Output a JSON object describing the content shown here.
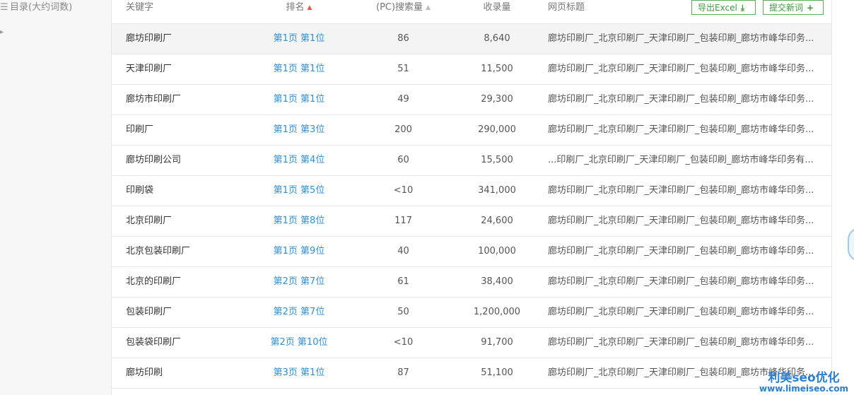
{
  "sidebar": {
    "items": [
      {
        "icon": "list-icon",
        "label": "目录(大约词数)"
      }
    ],
    "caret_icon": "caret-icon"
  },
  "table": {
    "headers": {
      "keyword": "关键字",
      "rank": "排名",
      "pc_search_volume": "(PC)搜索量",
      "indexed": "收录量",
      "page_title": "网页标题"
    },
    "rank_sort": "descending-active",
    "buttons": {
      "export_label": "导出Excel",
      "export_icon": "download-icon",
      "add_label": "提交新词",
      "add_icon": "plus-icon"
    },
    "rows": [
      {
        "keyword": "廊坊印刷厂",
        "rank": "第1页 第1位",
        "volume": "86",
        "indexed": "8,640",
        "title": "廊坊印刷厂_北京印刷厂_天津印刷厂_包装印刷_廊坊市峰华印务..."
      },
      {
        "keyword": "天津印刷厂",
        "rank": "第1页 第1位",
        "volume": "51",
        "indexed": "11,500",
        "title": "廊坊印刷厂_北京印刷厂_天津印刷厂_包装印刷_廊坊市峰华印务..."
      },
      {
        "keyword": "廊坊市印刷厂",
        "rank": "第1页 第1位",
        "volume": "49",
        "indexed": "29,300",
        "title": "廊坊印刷厂_北京印刷厂_天津印刷厂_包装印刷_廊坊市峰华印务..."
      },
      {
        "keyword": "印刷厂",
        "rank": "第1页 第3位",
        "volume": "200",
        "indexed": "290,000",
        "title": "廊坊印刷厂_北京印刷厂_天津印刷厂_包装印刷_廊坊市峰华印务..."
      },
      {
        "keyword": "廊坊印刷公司",
        "rank": "第1页 第4位",
        "volume": "60",
        "indexed": "15,500",
        "title": "...印刷厂_北京印刷厂_天津印刷厂_包装印刷_廊坊市峰华印务有..."
      },
      {
        "keyword": "印刷袋",
        "rank": "第1页 第5位",
        "volume": "<10",
        "indexed": "341,000",
        "title": "廊坊印刷厂_北京印刷厂_天津印刷厂_包装印刷_廊坊市峰华印务..."
      },
      {
        "keyword": "北京印刷厂",
        "rank": "第1页 第8位",
        "volume": "117",
        "indexed": "24,600",
        "title": "廊坊印刷厂_北京印刷厂_天津印刷厂_包装印刷_廊坊市峰华印务..."
      },
      {
        "keyword": "北京包装印刷厂",
        "rank": "第1页 第9位",
        "volume": "40",
        "indexed": "100,000",
        "title": "廊坊印刷厂_北京印刷厂_天津印刷厂_包装印刷_廊坊市峰华印务..."
      },
      {
        "keyword": "北京的印刷厂",
        "rank": "第2页 第7位",
        "volume": "61",
        "indexed": "38,400",
        "title": "廊坊印刷厂_北京印刷厂_天津印刷厂_包装印刷_廊坊市峰华印务..."
      },
      {
        "keyword": "包装印刷厂",
        "rank": "第2页 第7位",
        "volume": "50",
        "indexed": "1,200,000",
        "title": "廊坊印刷厂_北京印刷厂_天津印刷厂_包装印刷_廊坊市峰华印务..."
      },
      {
        "keyword": "包装袋印刷厂",
        "rank": "第2页 第10位",
        "volume": "<10",
        "indexed": "91,700",
        "title": "廊坊印刷厂_北京印刷厂_天津印刷厂_包装印刷_廊坊市峰华印务..."
      },
      {
        "keyword": "廊坊印刷",
        "rank": "第3页 第1位",
        "volume": "87",
        "indexed": "51,100",
        "title": "廊坊印刷厂_北京印刷厂_天津印刷厂_包装印刷_廊坊市峰华印务..."
      }
    ]
  },
  "watermark": {
    "brand": "利美seo优化",
    "url": "www.limeiseo.com"
  },
  "colors": {
    "link": "#2e8fd5",
    "button_green": "#3b9b3b",
    "sort_active": "#e05a4f"
  }
}
